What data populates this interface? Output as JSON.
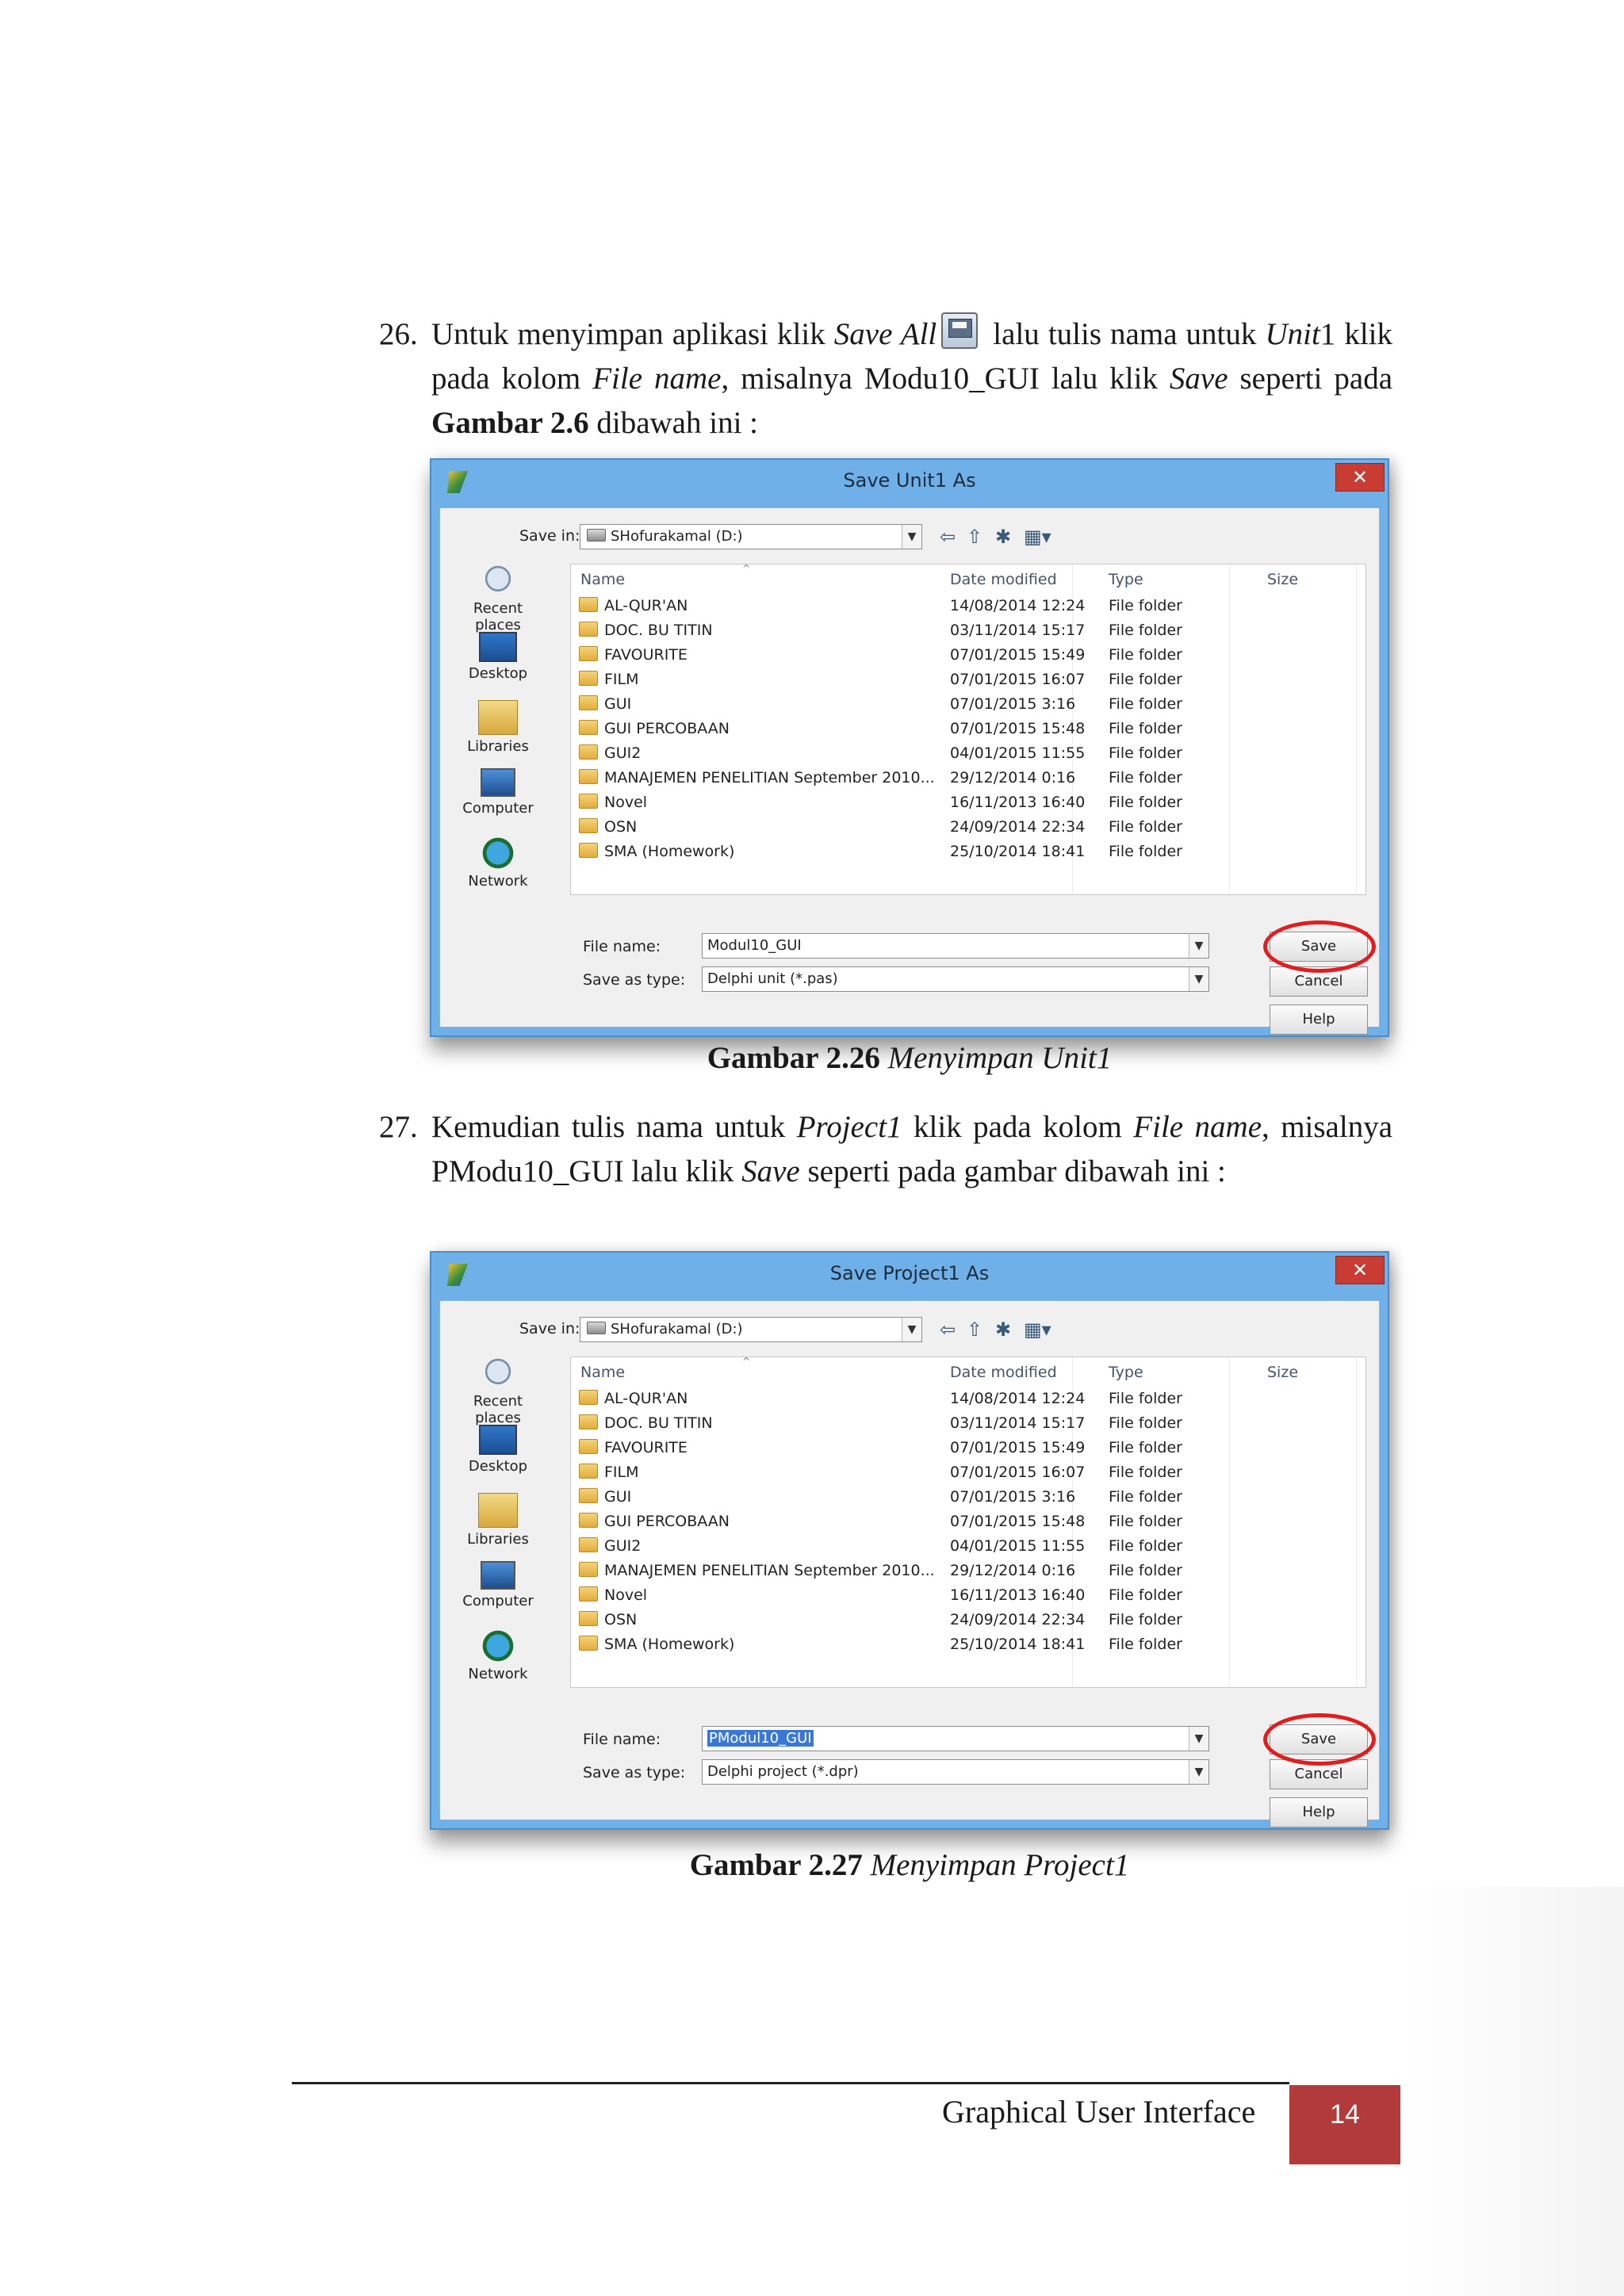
{
  "step26": {
    "number": "26.",
    "text_a": "Untuk menyimpan aplikasi klik ",
    "save_all": "Save All",
    "text_b": " lalu tulis nama untuk ",
    "unit": "Unit",
    "unit_num": "1 klik  pada kolom ",
    "file_name": "File name",
    "text_c": ", misalnya Modu10_GUI lalu klik ",
    "save": "Save",
    "text_d": " seperti pada ",
    "gambar": "Gambar  2.6",
    "text_e": "  dibawah  ini  :"
  },
  "step27": {
    "number": "27.",
    "text_a": "Kemudian tulis nama untuk ",
    "project": "Project1",
    "text_b": " klik pada kolom ",
    "file_name": "File name",
    "text_c": ", misalnya PModu10_GUI lalu klik ",
    "save": "Save",
    "text_d": " seperti pada gambar dibawah ini  :"
  },
  "captions": [
    {
      "label": "Gambar  2.26",
      "title": "Menyimpan Unit1"
    },
    {
      "label": "Gambar  2.27",
      "title": "Menyimpan Project1"
    }
  ],
  "dialogs": [
    {
      "title": "Save Unit1 As",
      "close": "✕",
      "save_in_label": "Save in:",
      "save_in_value": "SHofurakamal (D:)",
      "file_name_label": "File name:",
      "file_name_value": "Modul10_GUI",
      "save_as_type_label": "Save as type:",
      "save_as_type_value": "Delphi unit (*.pas)",
      "save_btn": "Save",
      "cancel_btn": "Cancel",
      "help_btn": "Help"
    },
    {
      "title": "Save Project1 As",
      "close": "✕",
      "save_in_label": "Save in:",
      "save_in_value": "SHofurakamal (D:)",
      "file_name_label": "File name:",
      "file_name_value": "PModul10_GUI",
      "save_as_type_label": "Save as type:",
      "save_as_type_value": "Delphi project (*.dpr)",
      "save_btn": "Save",
      "cancel_btn": "Cancel",
      "help_btn": "Help"
    }
  ],
  "places": [
    "Recent places",
    "Desktop",
    "Libraries",
    "Computer",
    "Network"
  ],
  "columns": {
    "name": "Name",
    "date": "Date modified",
    "type": "Type",
    "size": "Size"
  },
  "files": [
    {
      "name": "AL-QUR'AN",
      "date": "14/08/2014 12:24",
      "type": "File folder"
    },
    {
      "name": "DOC. BU TITIN",
      "date": "03/11/2014 15:17",
      "type": "File folder"
    },
    {
      "name": "FAVOURITE",
      "date": "07/01/2015 15:49",
      "type": "File folder"
    },
    {
      "name": "FILM",
      "date": "07/01/2015 16:07",
      "type": "File folder"
    },
    {
      "name": "GUI",
      "date": "07/01/2015 3:16",
      "type": "File folder"
    },
    {
      "name": "GUI PERCOBAAN",
      "date": "07/01/2015 15:48",
      "type": "File folder"
    },
    {
      "name": "GUI2",
      "date": "04/01/2015 11:55",
      "type": "File folder"
    },
    {
      "name": "MANAJEMEN PENELITIAN  September 2010...",
      "date": "29/12/2014 0:16",
      "type": "File folder"
    },
    {
      "name": "Novel",
      "date": "16/11/2013 16:40",
      "type": "File folder"
    },
    {
      "name": "OSN",
      "date": "24/09/2014 22:34",
      "type": "File folder"
    },
    {
      "name": "SMA (Homework)",
      "date": "25/10/2014 18:41",
      "type": "File folder"
    }
  ],
  "footer": {
    "title": "Graphical  User Interface",
    "page": "14"
  }
}
